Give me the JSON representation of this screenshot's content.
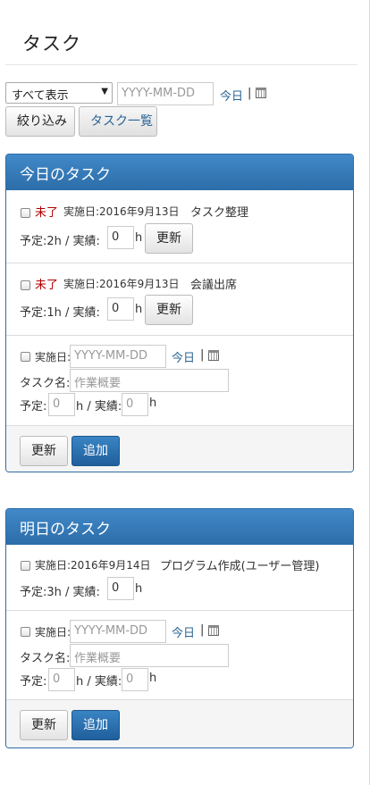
{
  "header": {
    "title": "タスク"
  },
  "filter": {
    "select_value": "すべて表示",
    "date_placeholder": "YYYY-MM-DD",
    "today_link": "今日",
    "separator": "|",
    "filter_button": "絞り込み",
    "list_button": "タスク一覧"
  },
  "today_panel": {
    "title": "今日のタスク",
    "tasks": [
      {
        "status": "未了",
        "date_label": "実施日:2016年9月13日",
        "name": "タスク整理",
        "plan_label": "予定:2h / 実績:",
        "actual": "0",
        "unit": "h",
        "update_button": "更新"
      },
      {
        "status": "未了",
        "date_label": "実施日:2016年9月13日",
        "name": "会議出席",
        "plan_label": "予定:1h / 実績:",
        "actual": "0",
        "unit": "h",
        "update_button": "更新"
      }
    ],
    "new_task": {
      "date_label": "実施日:",
      "date_placeholder": "YYYY-MM-DD",
      "today_link": "今日",
      "separator": "|",
      "name_label": "タスク名:",
      "name_placeholder": "作業概要",
      "plan_label": "予定:",
      "plan_value": "0",
      "mid_label": "h / 実績:",
      "actual_value": "0",
      "unit": "h"
    },
    "footer": {
      "update_button": "更新",
      "add_button": "追加"
    }
  },
  "tomorrow_panel": {
    "title": "明日のタスク",
    "tasks": [
      {
        "date_label": "実施日:2016年9月14日",
        "name": "プログラム作成(ユーザー管理)",
        "plan_label": "予定:3h / 実績:",
        "actual": "0",
        "unit": "h"
      }
    ],
    "new_task": {
      "date_label": "実施日:",
      "date_placeholder": "YYYY-MM-DD",
      "today_link": "今日",
      "separator": "|",
      "name_label": "タスク名:",
      "name_placeholder": "作業概要",
      "plan_label": "予定:",
      "plan_value": "0",
      "mid_label": "h / 実績:",
      "actual_value": "0",
      "unit": "h"
    },
    "footer": {
      "update_button": "更新",
      "add_button": "追加"
    }
  },
  "icons": {
    "calendar": "calendar-icon",
    "select_caret": "chevron-down-icon"
  },
  "colors": {
    "panel_header": "#337ab7",
    "status_unfinished": "#b30000",
    "link": "#2a6496",
    "primary_button": "#286090"
  }
}
